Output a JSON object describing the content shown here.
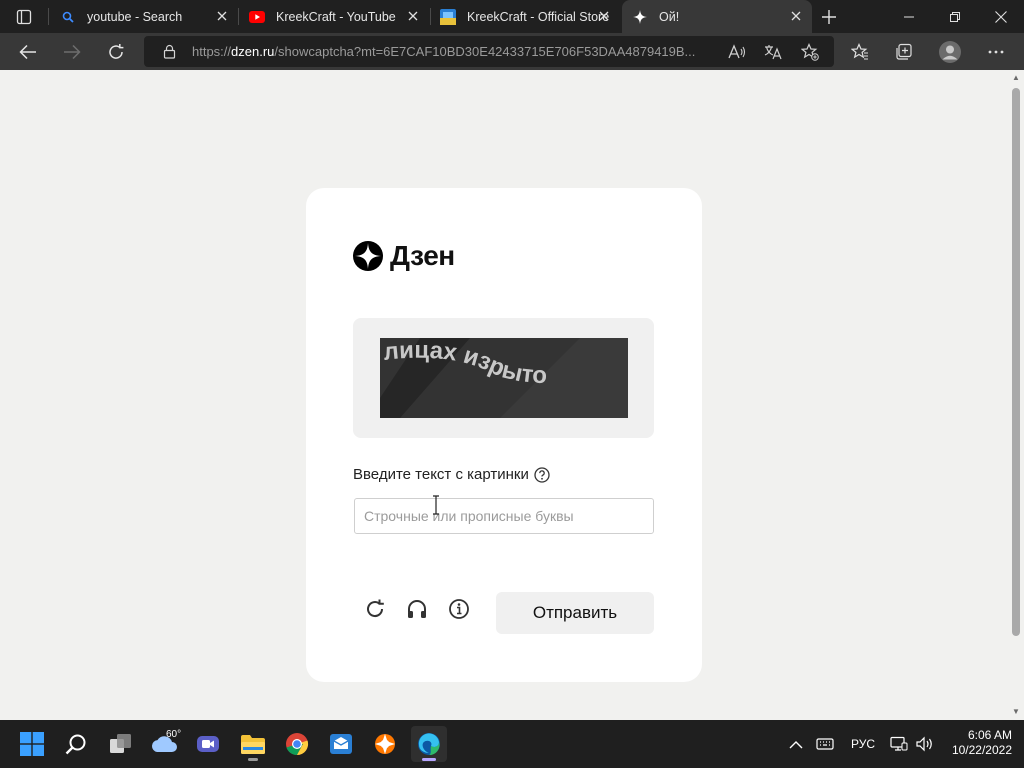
{
  "browser": {
    "tabs": [
      {
        "title": "youtube - Search",
        "icon": "search-icon"
      },
      {
        "title": "KreekCraft - YouTube",
        "icon": "youtube-icon"
      },
      {
        "title": "KreekCraft - Official Store",
        "icon": "store-icon"
      },
      {
        "title": "Ой!",
        "icon": "sparkle-icon"
      }
    ],
    "url": {
      "prefix": "https://",
      "host": "dzen.ru",
      "path": "/showcaptcha?mt=6E7CAF10BD30E42433715E706F53DAA4879419B..."
    }
  },
  "captcha_page": {
    "logo_text": "Дзен",
    "captcha_text": "лицах изрыто",
    "input_label": "Введите текст с картинки",
    "input_placeholder": "Строчные или прописные буквы",
    "submit_label": "Отправить"
  },
  "taskbar": {
    "weather_temp": "60°",
    "language": "РУС",
    "time": "6:06 AM",
    "date": "10/22/2022"
  },
  "colors": {
    "page_bg": "#f1f1ef",
    "card_bg": "#ffffff",
    "chrome_dark": "#202020",
    "chrome_mid": "#383838",
    "accent": "#b7a6ff"
  }
}
